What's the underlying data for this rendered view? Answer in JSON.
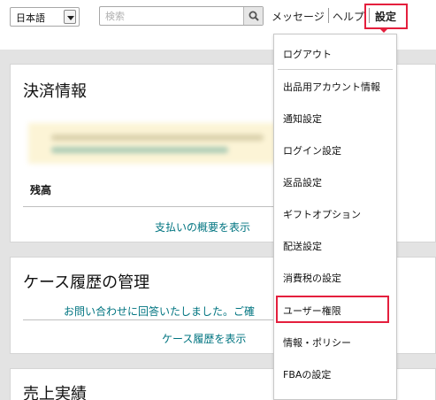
{
  "header": {
    "language": "日本語",
    "search_placeholder": "検索",
    "nav_messages": "メッセージ",
    "nav_help": "ヘルプ",
    "nav_settings": "設定"
  },
  "payment_card": {
    "title": "決済情報",
    "balance_label": "残高",
    "summary_link": "支払いの概要を表示"
  },
  "case_card": {
    "title": "ケース履歴の管理",
    "notice": "お問い合わせに回答いたしました。ご確",
    "history_link": "ケース履歴を表示"
  },
  "sales_card": {
    "title": "売上実績",
    "more_icon": "•••"
  },
  "settings_menu": {
    "items": [
      "ログアウト",
      "出品用アカウント情報",
      "通知設定",
      "ログイン設定",
      "返品設定",
      "ギフトオプション",
      "配送設定",
      "消費税の設定",
      "ユーザー権限",
      "情報・ポリシー",
      "FBAの設定"
    ],
    "highlighted": "ユーザー権限"
  },
  "colors": {
    "highlight": "#e41f3d",
    "link": "#007480",
    "background": "#e3e3e3"
  }
}
